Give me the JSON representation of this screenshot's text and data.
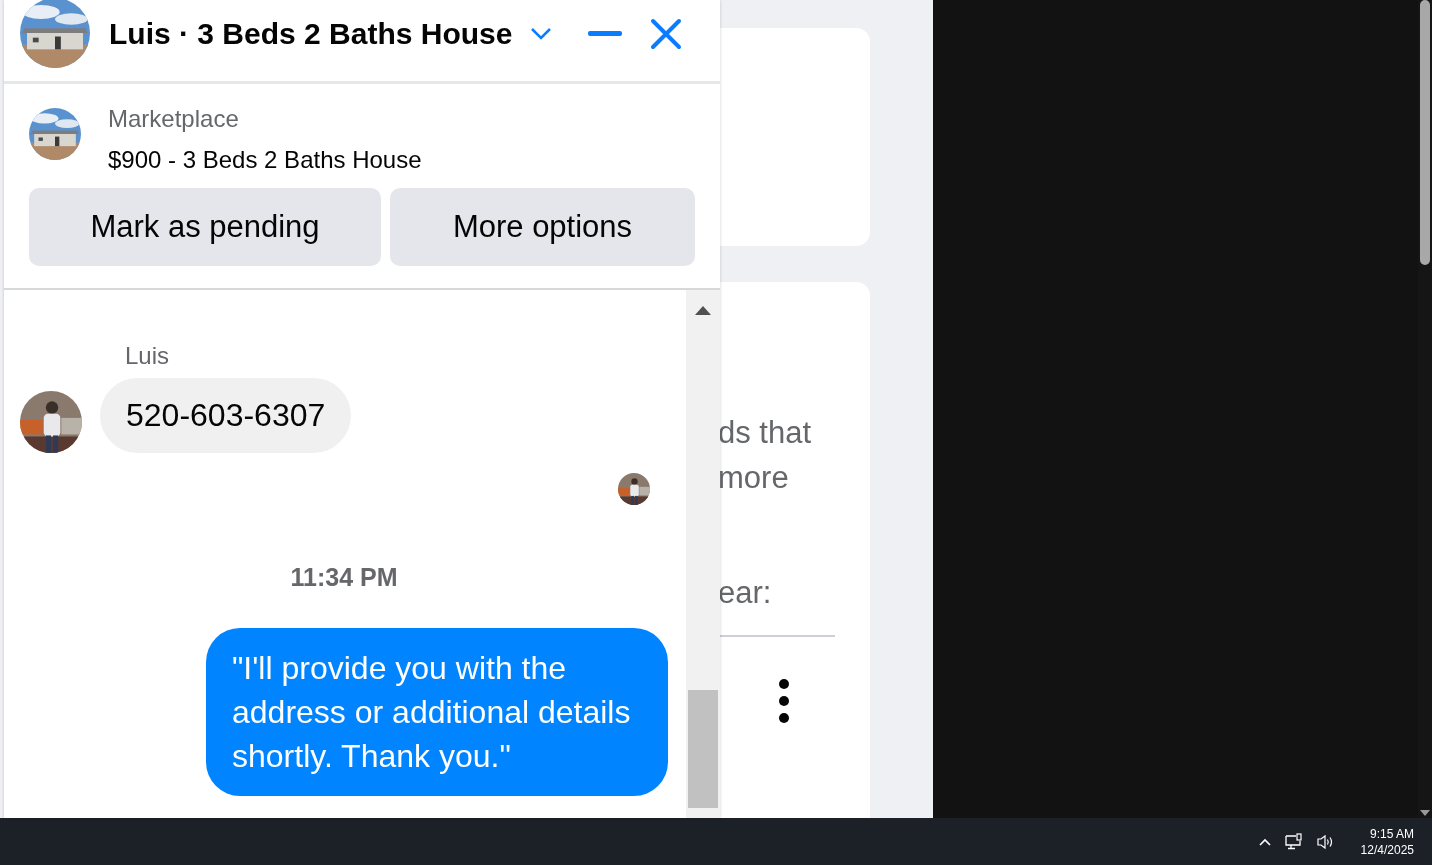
{
  "chat": {
    "title": "Luis · 3 Beds 2 Baths House",
    "listing": {
      "source": "Marketplace",
      "title": "$900 - 3 Beds 2 Baths House"
    },
    "actions": [
      "Mark as pending",
      "More options"
    ],
    "messages": [
      {
        "kind": "sender_name",
        "text": "Luis"
      },
      {
        "kind": "incoming",
        "text": "520-603-6307"
      },
      {
        "kind": "read_receipt"
      },
      {
        "kind": "timestamp",
        "text": "11:34 PM"
      },
      {
        "kind": "outgoing",
        "text": "\"I'll provide you with the address or additional details shortly. Thank you.\""
      }
    ]
  },
  "background": {
    "card_texts": [
      "ds that",
      "more",
      "ear:"
    ]
  },
  "taskbar": {
    "time": "9:15 AM",
    "date": "12/4/2025"
  }
}
